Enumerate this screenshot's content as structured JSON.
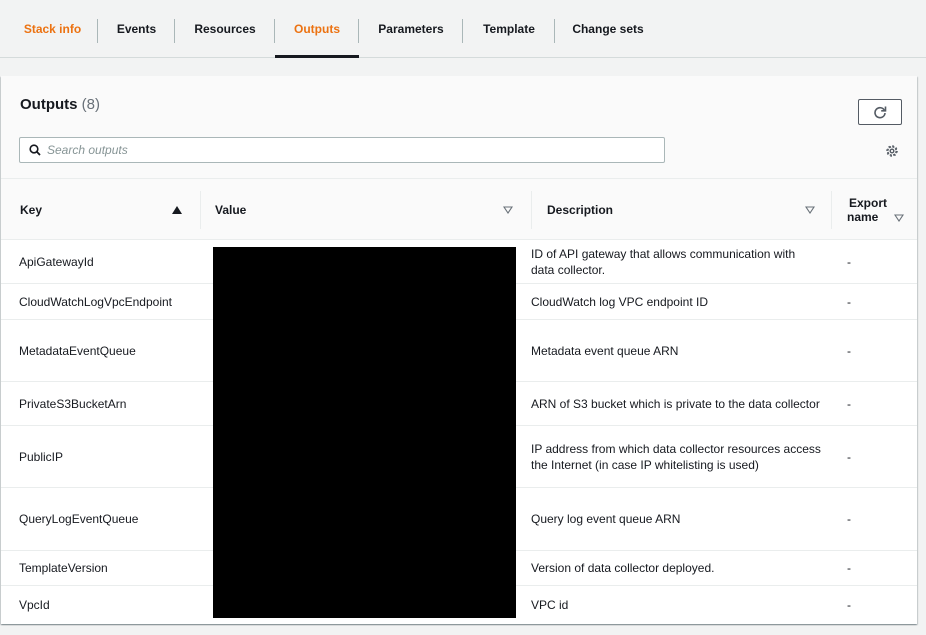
{
  "tabs": [
    {
      "label": "Stack info",
      "active": true
    },
    {
      "label": "Events"
    },
    {
      "label": "Resources"
    },
    {
      "label": "Outputs",
      "selected": true
    },
    {
      "label": "Parameters"
    },
    {
      "label": "Template"
    },
    {
      "label": "Change sets"
    }
  ],
  "outputs": {
    "title": "Outputs",
    "count": "(8)",
    "search_placeholder": "Search outputs",
    "columns": {
      "key": "Key",
      "value": "Value",
      "description": "Description",
      "export_line1": "Export",
      "export_line2": "name"
    },
    "rows": [
      {
        "key": "ApiGatewayId",
        "description": "ID of API gateway that allows communication with data collector.",
        "export": "-"
      },
      {
        "key": "CloudWatchLogVpcEndpoint",
        "description": "CloudWatch log VPC endpoint ID",
        "export": "-"
      },
      {
        "key": "MetadataEventQueue",
        "description": "Metadata event queue ARN",
        "export": "-"
      },
      {
        "key": "PrivateS3BucketArn",
        "description": "ARN of S3 bucket which is private to the data collector",
        "export": "-"
      },
      {
        "key": "PublicIP",
        "description": "IP address from which data collector resources access the Internet (in case IP whitelisting is used)",
        "export": "-"
      },
      {
        "key": "QueryLogEventQueue",
        "description": "Query log event queue ARN",
        "export": "-"
      },
      {
        "key": "TemplateVersion",
        "description": "Version of data collector deployed.",
        "export": "-"
      },
      {
        "key": "VpcId",
        "description": "VPC id",
        "export": "-"
      }
    ]
  },
  "colors": {
    "accent": "#ec7211",
    "text": "#16191f",
    "border": "#eaeded"
  }
}
